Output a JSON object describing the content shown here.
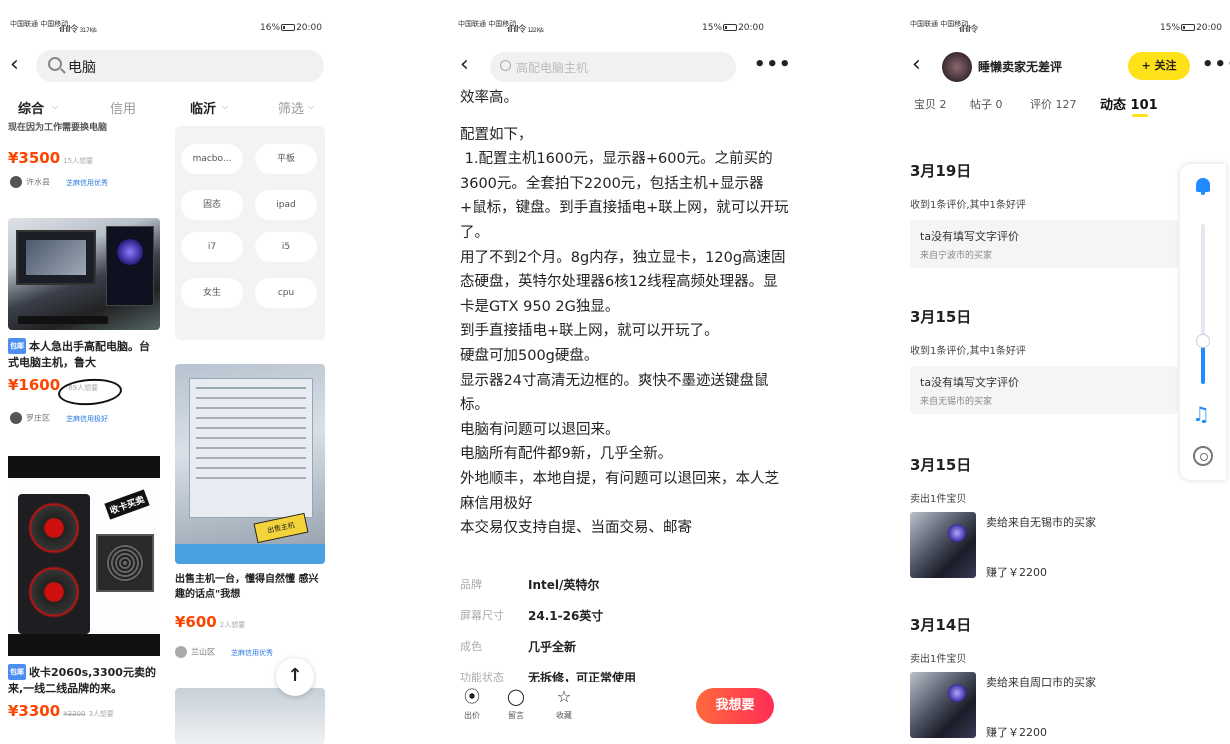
{
  "screen1": {
    "status": {
      "left": "中国联通 中国移动",
      "signal": "ᐧıllᐧıll令",
      "speed": "31.7 K/s",
      "battery": "16%",
      "time": "20:00"
    },
    "search_query": "电脑",
    "filters": [
      "综合",
      "信用",
      "临沂",
      "筛选"
    ],
    "active_filter": "临沂",
    "cards_left": [
      {
        "title_partial": "现在因为工作需要换电脑",
        "price": "¥3500",
        "want": "15人想要",
        "seller": "许水县",
        "credit": "芝麻信用优秀"
      },
      {
        "tag": "包邮",
        "title": "本人急出手高配电脑。台式电脑主机，鲁大",
        "price": "¥1600",
        "want": "89人想要",
        "seller": "罗庄区",
        "credit": "芝麻信用极好"
      },
      {
        "tag": "包邮",
        "title": "收卡2060s,3300元卖的来,一线二线品牌的来。",
        "price": "¥3300",
        "original": "¥3300",
        "want": "3人想要",
        "sticker": "收卡买卖"
      }
    ],
    "suggestions": [
      "macbo...",
      "平板",
      "固态",
      "ipad",
      "i7",
      "i5",
      "女生",
      "cpu"
    ],
    "card_right": {
      "title": "出售主机一台，懂得自然懂 感兴趣的话点\"我想",
      "price": "¥600",
      "want": "2人想要",
      "seller": "兰山区",
      "credit": "芝麻信用优秀",
      "sticker": "出售主机"
    },
    "back_to_top": "↑"
  },
  "screen2": {
    "status": {
      "left": "中国联通 中国移动",
      "signal": "ᐧıllᐧıll令",
      "speed": "122 K/s",
      "battery": "15%",
      "time": "20:00"
    },
    "search_placeholder": "高配电脑主机",
    "more": "•••",
    "description": [
      "效率高。",
      "",
      "配置如下，",
      " 1.配置主机1600元，显示器+600元。之前买的3600元。全套拍下2200元，包括主机+显示器+鼠标，键盘。到手直接插电+联上网，就可以开玩了。",
      "用了不到2个月。8g内存，独立显卡，120g高速固态硬盘，英特尔处理器6核12线程高频处理器。显卡是GTX 950 2G独显。",
      "到手直接插电+联上网，就可以开玩了。",
      "硬盘可加500g硬盘。",
      "显示器24寸高清无边框的。爽快不墨迹送键盘鼠标。",
      "电脑有问题可以退回来。",
      "电脑所有配件都9新，几乎全新。",
      "外地顺丰，本地自提，有问题可以退回来，本人芝麻信用极好",
      "本交易仅支持自提、当面交易、邮寄"
    ],
    "props": [
      {
        "k": "品牌",
        "v": "Intel/英特尔"
      },
      {
        "k": "屏幕尺寸",
        "v": "24.1-26英寸"
      },
      {
        "k": "成色",
        "v": "几乎全新"
      },
      {
        "k": "功能状态",
        "v": "无拆修，可正常使用"
      }
    ],
    "actions": [
      {
        "icon": "bargain-icon",
        "label": "出价"
      },
      {
        "icon": "comment-icon",
        "label": "留言"
      },
      {
        "icon": "star-icon",
        "label": "收藏"
      }
    ],
    "want_button": "我想要"
  },
  "screen3": {
    "status": {
      "left": "中国联通 中国移动",
      "signal": "ᐧıllᐧıll令",
      "battery": "15%",
      "time": "20:00"
    },
    "seller_name": "睡懒卖家无差评",
    "follow": "+ 关注",
    "tabs": [
      "宝贝 2",
      "帖子 0",
      "评价 127",
      "动态 101"
    ],
    "active_tab": "动态 101",
    "timeline": [
      {
        "date": "3月19日",
        "note": "收到1条评价,其中1条好评",
        "review": "ta没有填写文字评价",
        "from": "来自宁波市的买家"
      },
      {
        "date": "3月15日",
        "note": "收到1条评价,其中1条好评",
        "review": "ta没有填写文字评价",
        "from": "来自无锡市的买家"
      },
      {
        "date": "3月15日",
        "note": "卖出1件宝贝",
        "buyer": "卖给来自无锡市的买家",
        "earned": "赚了￥2200"
      },
      {
        "date": "3月14日",
        "note": "卖出1件宝贝",
        "buyer": "卖给来自周口市的买家",
        "earned": "赚了￥2200"
      }
    ],
    "side_panel": {
      "volume": 0.6,
      "music_icon": "♫"
    }
  }
}
